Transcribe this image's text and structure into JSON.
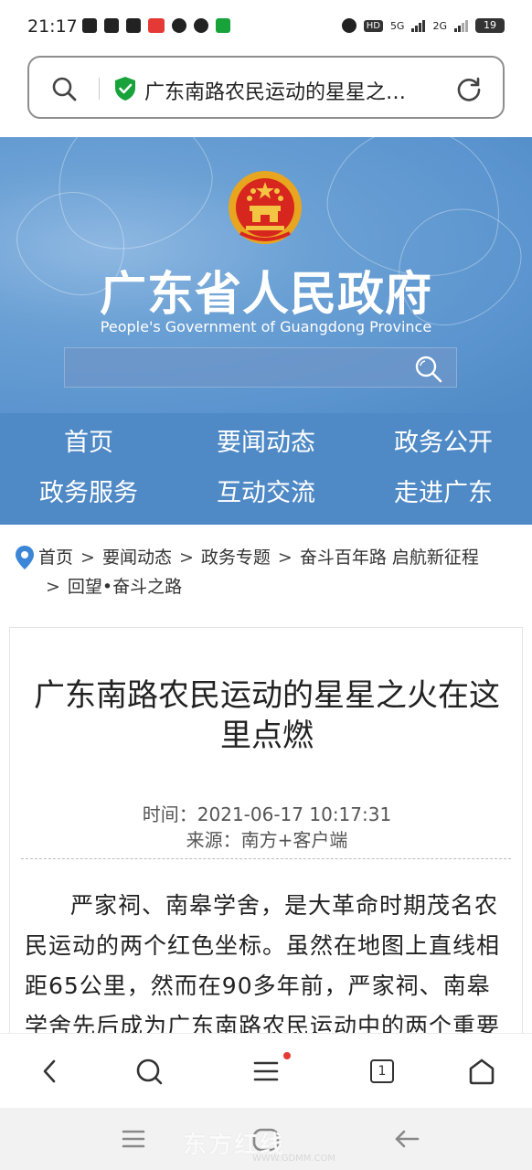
{
  "status_bar": {
    "time": "21:17",
    "network_1": "5G",
    "network_2": "2G",
    "hd_label": "HD",
    "battery": "19"
  },
  "browser": {
    "url_title": "广东南路农民运动的星星之…",
    "tab_count": "1",
    "icons": {
      "search": "search-icon",
      "secure": "shield-check-icon",
      "reload": "reload-icon",
      "back": "chevron-left-icon",
      "menu": "hamburger-icon",
      "home": "home-icon"
    }
  },
  "site": {
    "title": "广东省人民政府",
    "subtitle": "People's Government of Guangdong Province",
    "nav": [
      "首页",
      "要闻动态",
      "政务公开",
      "政务服务",
      "互动交流",
      "走进广东"
    ]
  },
  "breadcrumb": {
    "items": [
      "首页",
      "要闻动态",
      "政务专题",
      "奋斗百年路 启航新征程",
      "回望•奋斗之路"
    ]
  },
  "article": {
    "title": "广东南路农民运动的星星之火在这里点燃",
    "time": "时间：2021-06-17 10:17:31",
    "source": "来源：南方+客户端",
    "body": "严家祠、南皋学舍，是大革命时期茂名农民运动的两个红色坐标。虽然在地图上直线相距65公里，然而在90多年前，严家祠、南皋学舍先后成为广东南路农民运动中的两个重要支"
  },
  "watermark": {
    "text": "东方红线",
    "url": "WWW.GDMM.COM"
  },
  "colors": {
    "banner_blue": "#5c95cf",
    "nav_blue": "#4f8ac6",
    "secure_green": "#18a33a",
    "notification_red": "#e53935"
  }
}
